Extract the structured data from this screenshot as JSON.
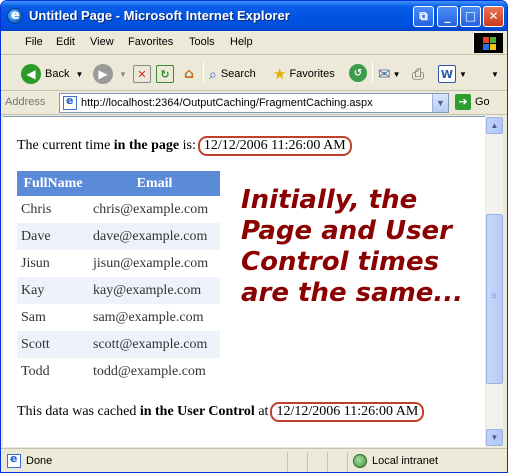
{
  "window": {
    "title": "Untitled Page - Microsoft Internet Explorer"
  },
  "menu": [
    "File",
    "Edit",
    "View",
    "Favorites",
    "Tools",
    "Help"
  ],
  "toolbar": {
    "back_label": "Back",
    "search_label": "Search",
    "favorites_label": "Favorites"
  },
  "address": {
    "label": "Address",
    "url": "http://localhost:2364/OutputCaching/FragmentCaching.aspx",
    "go_label": "Go"
  },
  "page": {
    "line1_prefix": "The current time ",
    "line1_bold": "in the page",
    "line1_suffix": " is:",
    "page_time": "12/12/2006 11:26:00 AM",
    "table_headers": [
      "FullName",
      "Email"
    ],
    "rows": [
      {
        "name": "Chris",
        "email": "chris@example.com"
      },
      {
        "name": "Dave",
        "email": "dave@example.com"
      },
      {
        "name": "Jisun",
        "email": "jisun@example.com"
      },
      {
        "name": "Kay",
        "email": "kay@example.com"
      },
      {
        "name": "Sam",
        "email": "sam@example.com"
      },
      {
        "name": "Scott",
        "email": "scott@example.com"
      },
      {
        "name": "Todd",
        "email": "todd@example.com"
      }
    ],
    "callout": "Initially, the Page and User Control times are the same...",
    "line2_prefix": "This data was cached ",
    "line2_bold": "in the User Control",
    "line2_suffix": " at",
    "control_time": "12/12/2006 11:26:00 AM"
  },
  "status": {
    "text": "Done",
    "zone": "Local intranet"
  },
  "colors": {
    "titlebar": "#0054e3",
    "table_header": "#5b8ad8",
    "callout": "#8b0000",
    "highlight": "#c0412b"
  }
}
